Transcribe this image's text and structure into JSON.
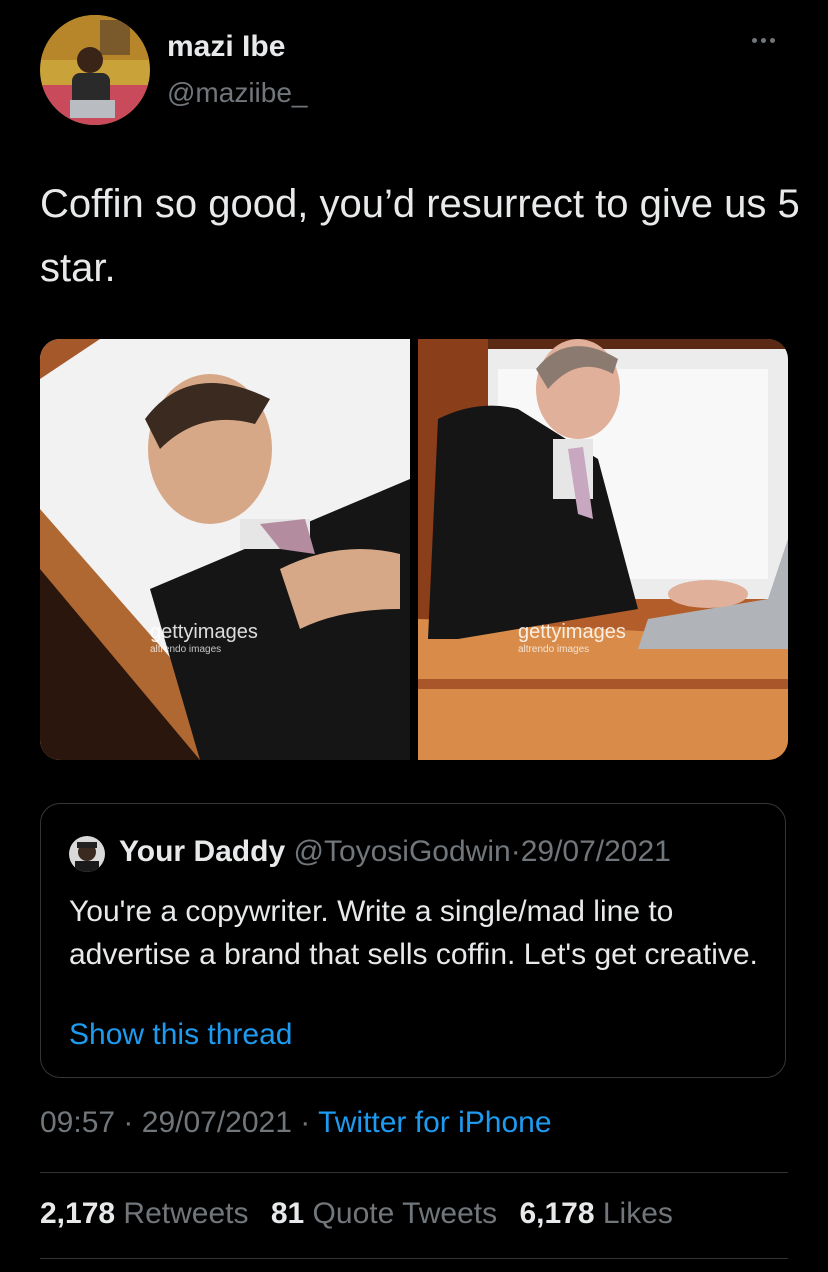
{
  "author": {
    "name": "mazi Ibe",
    "handle": "@maziibe_",
    "avatar_icon": "user-avatar-photo",
    "more_icon": "more-options-icon"
  },
  "tweet": {
    "text": "Coffin so good, you’d resurrect to give us 5 star."
  },
  "media": [
    {
      "watermark": "gettyimages",
      "watermark_sub": "altrendo images",
      "description_icon": "man-lying-in-coffin-photo"
    },
    {
      "watermark": "gettyimages",
      "watermark_sub": "altrendo images",
      "description_icon": "man-in-coffin-with-laptop-photo"
    }
  ],
  "quoted_tweet": {
    "name": "Your Daddy",
    "handle": "@ToyosiGodwin",
    "separator": "·",
    "date": "29/07/2021",
    "text": "You're a copywriter. Write a single/mad line to advertise a brand that sells coffin. Let's get creative.",
    "show_thread": "Show this thread"
  },
  "meta": {
    "time": "09:57",
    "separator": "·",
    "date": "29/07/2021",
    "source": "Twitter for iPhone"
  },
  "stats": {
    "retweets_count": "2,178",
    "retweets_label": "Retweets",
    "quotes_count": "81",
    "quotes_label": "Quote Tweets",
    "likes_count": "6,178",
    "likes_label": "Likes"
  },
  "colors": {
    "background": "#000000",
    "text": "#e7e9ea",
    "secondary": "#71767b",
    "link": "#1d9bf0",
    "border": "#333639"
  }
}
